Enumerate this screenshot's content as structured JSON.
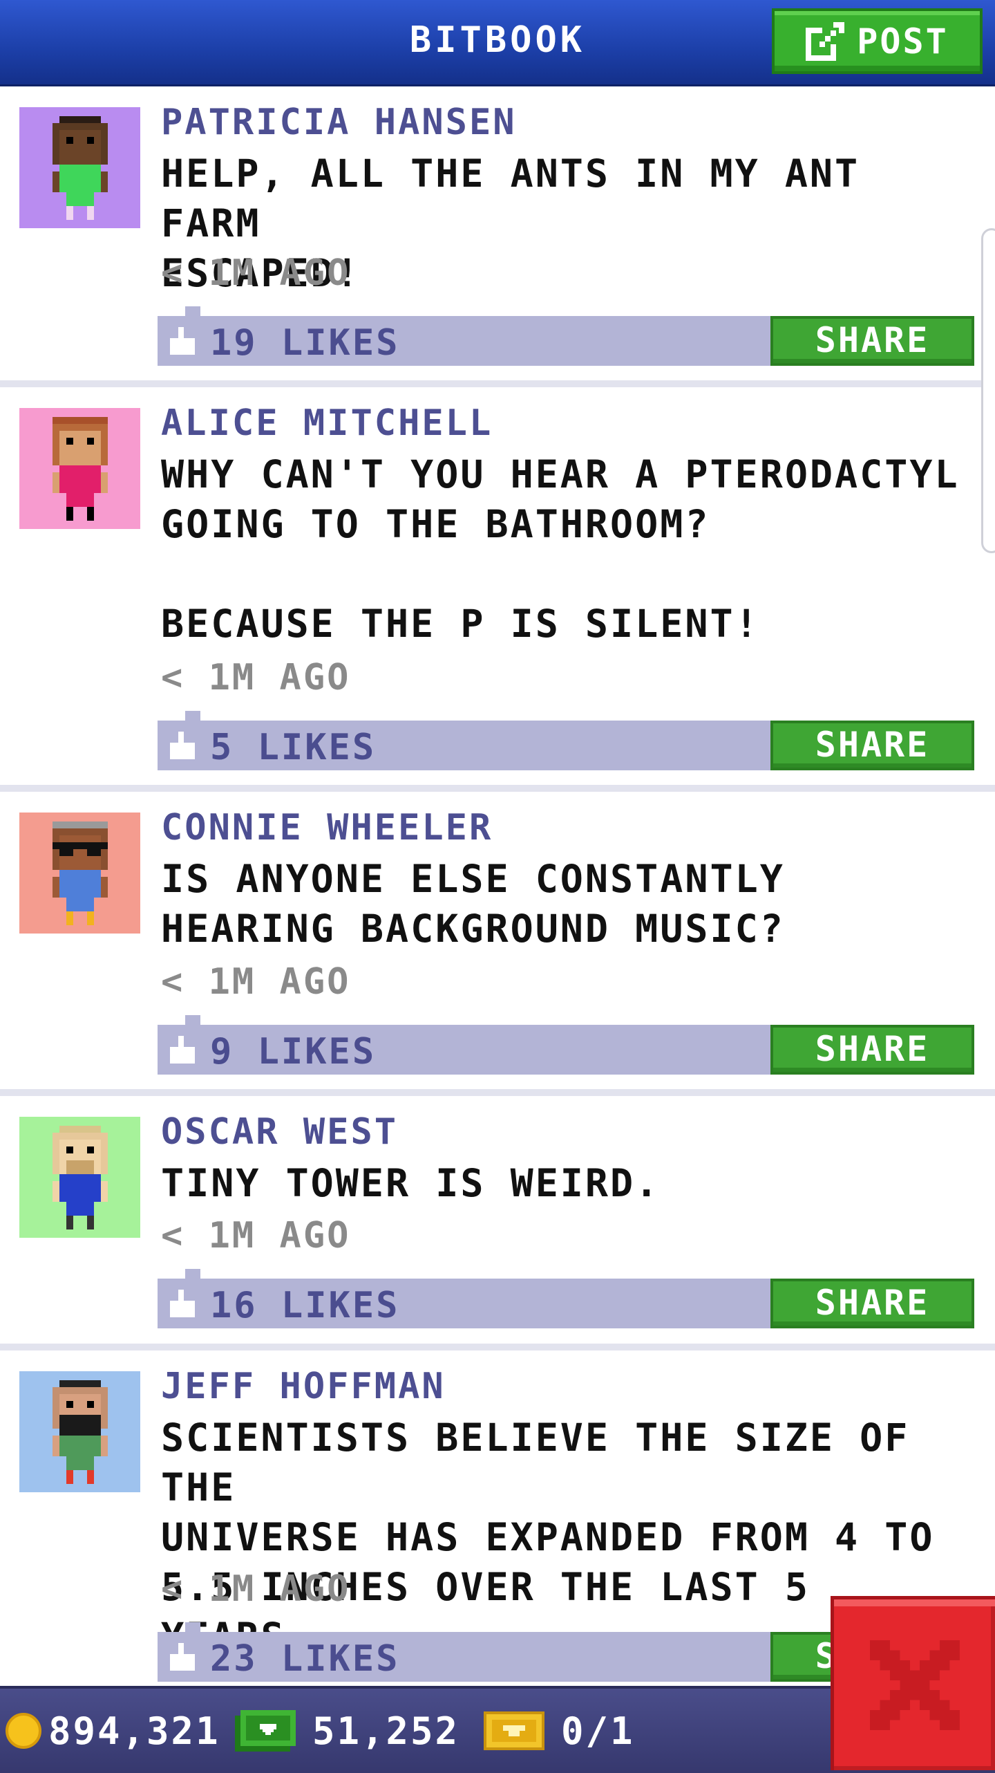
{
  "header": {
    "title": "BITBOOK",
    "post_label": "POST"
  },
  "posts": [
    {
      "author": "PATRICIA HANSEN",
      "text": "HELP, ALL THE ANTS IN MY ANT FARM\nESCAPED!",
      "time": "< 1M AGO",
      "likes": "19 LIKES",
      "share_label": "SHARE",
      "avatar_bg": "#b98cf0"
    },
    {
      "author": "ALICE MITCHELL",
      "text": "WHY CAN'T YOU HEAR A PTERODACTYL\nGOING TO THE BATHROOM?\n\nBECAUSE THE P IS SILENT!",
      "time": "< 1M AGO",
      "likes": "5 LIKES",
      "share_label": "SHARE",
      "avatar_bg": "#f79bcf"
    },
    {
      "author": "CONNIE WHEELER",
      "text": "IS ANYONE ELSE CONSTANTLY\nHEARING BACKGROUND MUSIC?",
      "time": "< 1M AGO",
      "likes": "9 LIKES",
      "share_label": "SHARE",
      "avatar_bg": "#f49c8f"
    },
    {
      "author": "OSCAR WEST",
      "text": "TINY TOWER IS WEIRD.",
      "time": "< 1M AGO",
      "likes": "16 LIKES",
      "share_label": "SHARE",
      "avatar_bg": "#a6f29a"
    },
    {
      "author": "JEFF HOFFMAN",
      "text": "SCIENTISTS BELIEVE THE SIZE OF THE\nUNIVERSE HAS EXPANDED FROM 4 TO\n5.5 INCHES OVER THE LAST 5 YEARS.",
      "time": "< 1M AGO",
      "likes": "23 LIKES",
      "share_label": "SHARE",
      "avatar_bg": "#9ec2ee"
    }
  ],
  "currency": {
    "coins": "894,321",
    "bux": "51,252",
    "tickets": "0/1"
  },
  "colors": {
    "header_blue": "#1c3fa8",
    "share_green": "#3fa634",
    "like_bar": "#b3b4d6",
    "close_red": "#e4272d"
  }
}
